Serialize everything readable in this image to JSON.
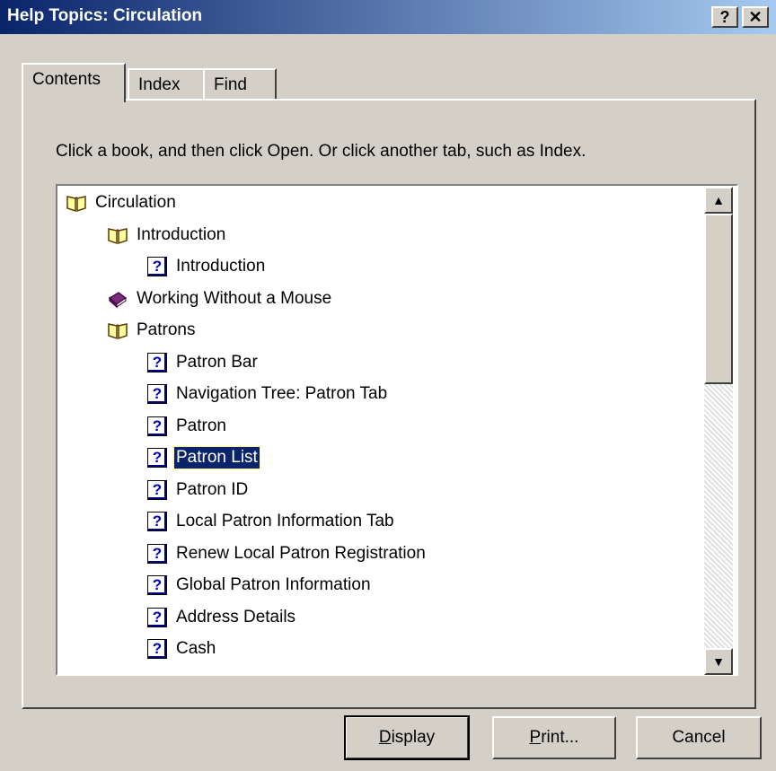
{
  "window": {
    "title": "Help Topics: Circulation"
  },
  "titlebar_buttons": {
    "help": "?",
    "close": "✕"
  },
  "tabs": [
    {
      "label": "Contents",
      "active": true
    },
    {
      "label": "Index",
      "active": false
    },
    {
      "label": "Find",
      "active": false
    }
  ],
  "instruction": "Click a book, and then click Open. Or click another tab, such as Index.",
  "tree": [
    {
      "label": "Circulation",
      "icon": "open-book-icon",
      "level": 0
    },
    {
      "label": "Introduction",
      "icon": "open-book-icon",
      "level": 1
    },
    {
      "label": "Introduction",
      "icon": "help-page-icon",
      "level": 2
    },
    {
      "label": "Working Without a Mouse",
      "icon": "closed-book-icon",
      "level": 1
    },
    {
      "label": "Patrons",
      "icon": "open-book-icon",
      "level": 1
    },
    {
      "label": "Patron Bar",
      "icon": "help-page-icon",
      "level": 2
    },
    {
      "label": "Navigation Tree: Patron Tab",
      "icon": "help-page-icon",
      "level": 2
    },
    {
      "label": "Patron",
      "icon": "help-page-icon",
      "level": 2
    },
    {
      "label": "Patron List",
      "icon": "help-page-icon",
      "level": 2,
      "selected": true
    },
    {
      "label": "Patron ID",
      "icon": "help-page-icon",
      "level": 2
    },
    {
      "label": "Local Patron Information Tab",
      "icon": "help-page-icon",
      "level": 2
    },
    {
      "label": "Renew Local Patron Registration",
      "icon": "help-page-icon",
      "level": 2
    },
    {
      "label": "Global Patron Information",
      "icon": "help-page-icon",
      "level": 2
    },
    {
      "label": "Address Details",
      "icon": "help-page-icon",
      "level": 2
    },
    {
      "label": "Cash",
      "icon": "help-page-icon",
      "level": 2
    }
  ],
  "buttons": {
    "display": {
      "prefix": "",
      "accel": "D",
      "rest": "isplay"
    },
    "print": {
      "prefix": "",
      "accel": "P",
      "rest": "rint..."
    },
    "cancel": "Cancel"
  },
  "colors": {
    "titlebar": "#0a246a",
    "face": "#d4d0c8",
    "selection": "#0a246a"
  }
}
